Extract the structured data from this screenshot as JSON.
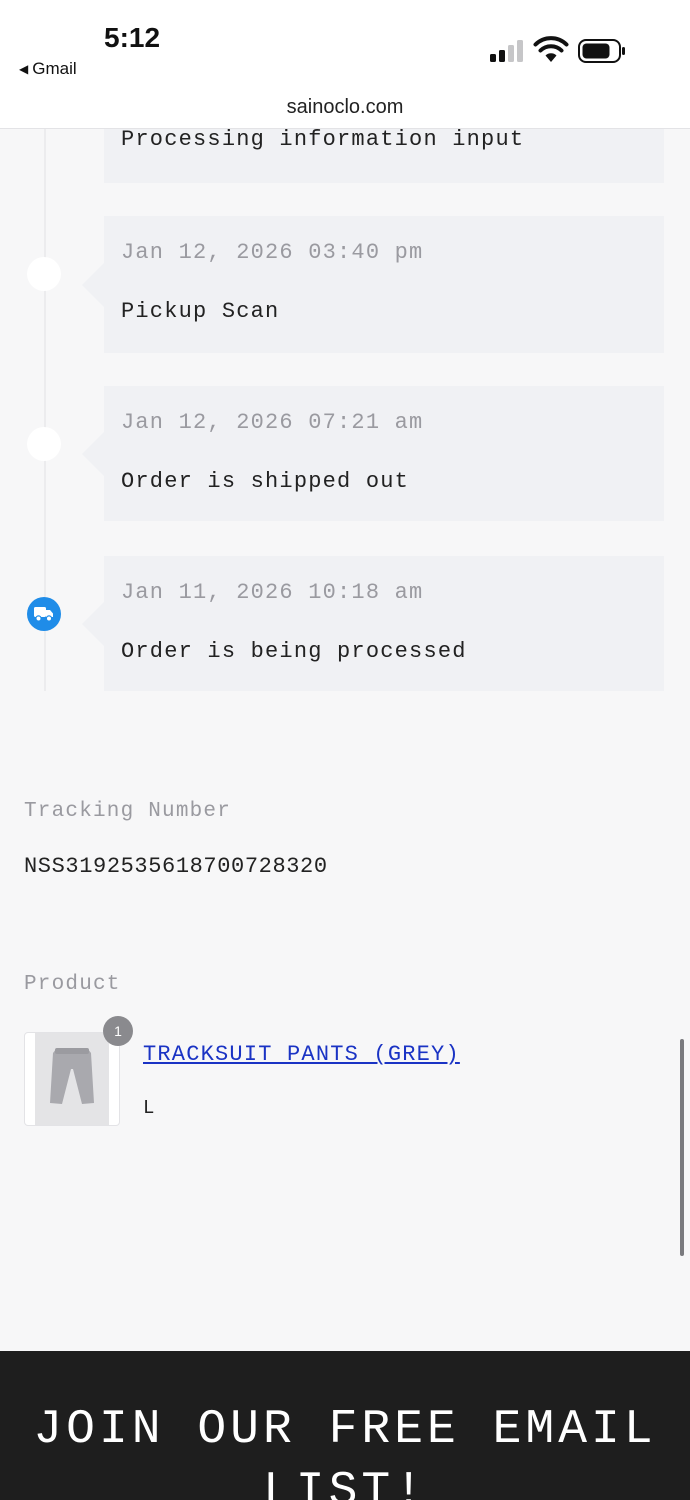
{
  "status_bar": {
    "time": "5:12",
    "back_label": "Gmail",
    "icons": [
      "cellular-signal-icon",
      "wifi-icon",
      "battery-icon"
    ]
  },
  "browser": {
    "url": "sainoclo.com"
  },
  "timeline": {
    "events": [
      {
        "date": "",
        "description": "Processing information input"
      },
      {
        "date": "Jan 12, 2026 03:40 pm",
        "description": "Pickup Scan"
      },
      {
        "date": "Jan 12, 2026 07:21 am",
        "description": "Order is shipped out"
      },
      {
        "date": "Jan 11, 2026 10:18 am",
        "description": "Order is being processed",
        "icon": "truck-icon"
      }
    ]
  },
  "tracking": {
    "label": "Tracking Number",
    "number": "NSS3192535618700728320"
  },
  "product": {
    "label": "Product",
    "name": "TRACKSUIT PANTS (GREY)",
    "variant": "L",
    "quantity": "1"
  },
  "footer": {
    "title": "JOIN OUR FREE EMAIL LIST!"
  },
  "colors": {
    "accent_blue": "#1f8ce8",
    "link": "#1a33c4",
    "footer_bg": "#1e1e1e",
    "page_bg": "#f7f7f8"
  }
}
